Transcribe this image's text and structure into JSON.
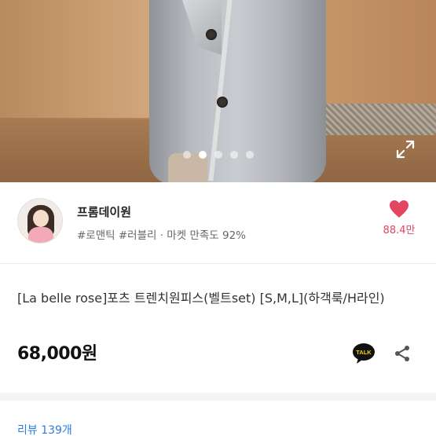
{
  "gallery": {
    "page_count": 5,
    "active_index": 1,
    "icons": {
      "expand": "expand-arrows-icon"
    }
  },
  "seller": {
    "name": "프롬데이원",
    "tags": "#로맨틱 #러블리 · 마켓 만족도 92%",
    "like_count": "88.4만",
    "like_color": "#e54563"
  },
  "product": {
    "title": "[La belle rose]포츠 트렌치원피스(벨트set) [S,M,L](하객룩/H라인)",
    "price": "68,000원",
    "talk_label": "TALK"
  },
  "tabs": {
    "review": "리뷰 139개"
  },
  "colors": {
    "accent_pink": "#e54563",
    "review_blue": "#2d7de0",
    "talk_yellow": "#f5d400"
  }
}
